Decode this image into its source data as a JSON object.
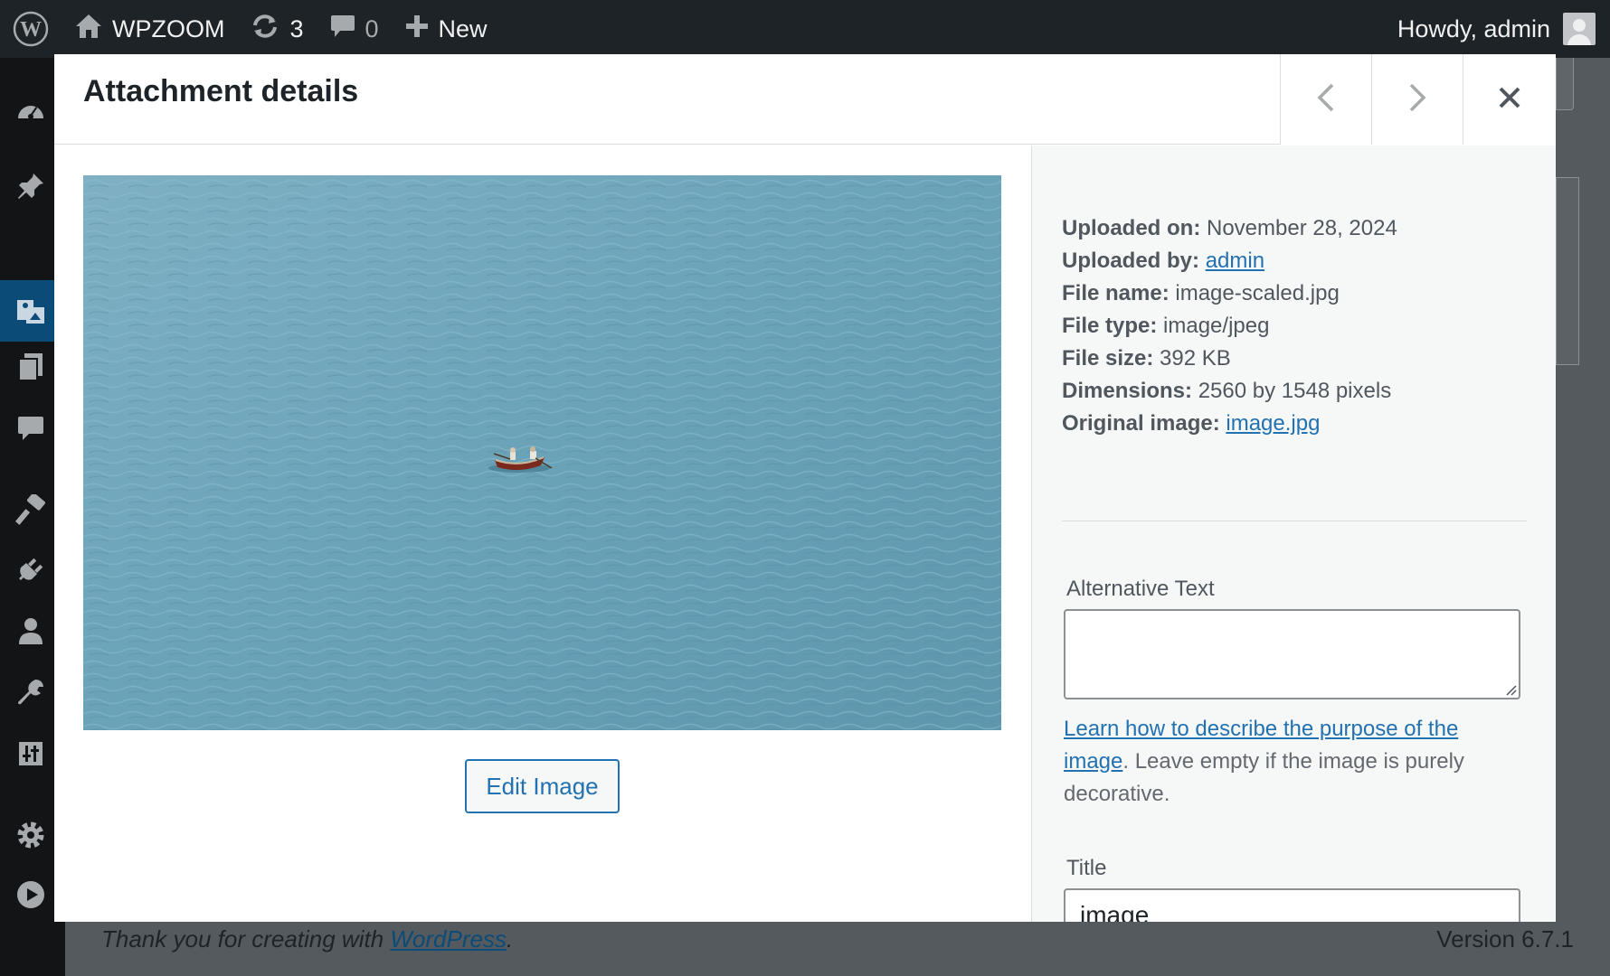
{
  "adminbar": {
    "site_name": "WPZOOM",
    "updates_count": "3",
    "comments_count": "0",
    "new_label": "New",
    "greeting": "Howdy, admin"
  },
  "modal": {
    "title": "Attachment details",
    "prev_label": "Previous",
    "next_label": "Next",
    "close_label": "Close"
  },
  "media": {
    "edit_button": "Edit Image"
  },
  "details": {
    "uploaded_on_label": "Uploaded on:",
    "uploaded_on": "November 28, 2024",
    "uploaded_by_label": "Uploaded by:",
    "uploaded_by": "admin",
    "file_name_label": "File name:",
    "file_name": "image-scaled.jpg",
    "file_type_label": "File type:",
    "file_type": "image/jpeg",
    "file_size_label": "File size:",
    "file_size": "392 KB",
    "dimensions_label": "Dimensions:",
    "dimensions": "2560 by 1548 pixels",
    "original_label": "Original image:",
    "original": "image.jpg",
    "alt_label": "Alternative Text",
    "alt_value": "",
    "help_link": "Learn how to describe the purpose of the image",
    "help_text": ". Leave empty if the image is purely decorative.",
    "title_label": "Title",
    "title_value": "image"
  },
  "footer": {
    "thanks_prefix": "Thank you for creating with ",
    "thanks_link": "WordPress",
    "thanks_suffix": ".",
    "version": "Version 6.7.1"
  },
  "colors": {
    "accent": "#2271b1",
    "adminbar": "#1d2327",
    "sidebar_active": "#0a4b78"
  }
}
